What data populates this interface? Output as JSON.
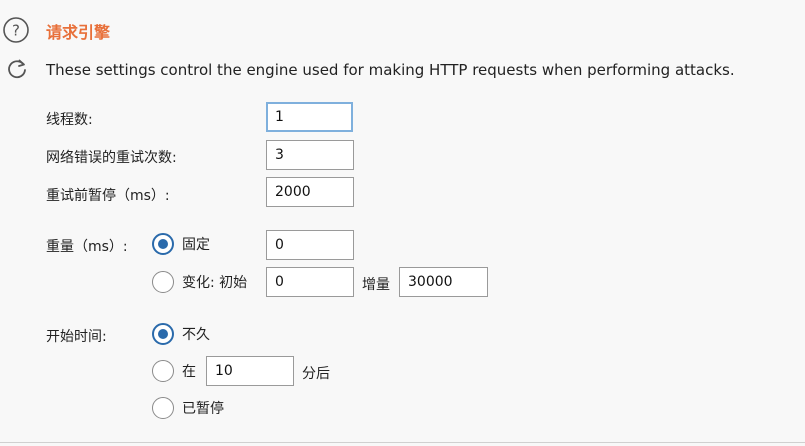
{
  "header": {
    "title": "请求引擎",
    "description": "These settings control the engine used for making HTTP requests when performing attacks."
  },
  "threads": {
    "label": "线程数:",
    "value": "1"
  },
  "retries": {
    "label": "网络错误的重试次数:",
    "value": "3"
  },
  "pause_before_retry": {
    "label": "重试前暂停（ms）:",
    "value": "2000"
  },
  "throttle": {
    "label": "重量（ms）:",
    "fixed": {
      "label": "固定",
      "value": "0",
      "selected": true
    },
    "variable": {
      "label": "变化: 初始",
      "start_value": "0",
      "step_label": "增量",
      "step_value": "30000",
      "selected": false
    }
  },
  "start_time": {
    "label": "开始时间:",
    "options": [
      {
        "label": "不久",
        "selected": true
      },
      {
        "label": "在",
        "value": "10",
        "suffix": "分后",
        "selected": false
      },
      {
        "label": "已暂停",
        "selected": false
      }
    ]
  },
  "icons": {
    "help": "help-icon",
    "refresh": "refresh-icon"
  },
  "colors": {
    "accent": "#e8703a",
    "radio_selected": "#2a6aab",
    "focus_border": "#7fb0dd"
  }
}
